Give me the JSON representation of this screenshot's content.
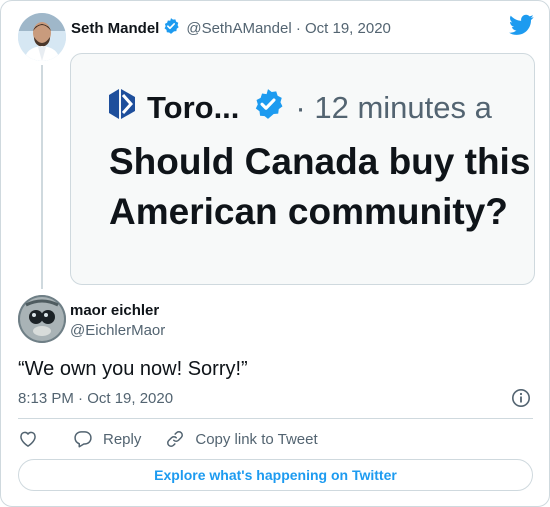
{
  "quoted_tweet": {
    "author_name": "Seth Mandel",
    "author_handle": "@SethAMandel",
    "date": "Oct 19, 2020",
    "embed": {
      "source_name": "Toro...",
      "time": "· 12 minutes a",
      "text_line1": "Should Canada buy this",
      "text_line2": "American community?"
    }
  },
  "tweet": {
    "author_name": "maor eichler",
    "author_handle": "@EichlerMaor",
    "text": "“We own you now! Sorry!”",
    "timestamp": "8:13 PM · Oct 19, 2020"
  },
  "actions": {
    "reply_label": "Reply",
    "copy_link_label": "Copy link to Tweet"
  },
  "explore_label": "Explore what's happening on Twitter",
  "colors": {
    "twitter_blue": "#1d9bf0",
    "text_primary": "#0f1419",
    "text_secondary": "#536471",
    "border": "#cfd9de",
    "toronto_brand": "#1e4f9c"
  },
  "icons": {
    "verified": "verified-badge-icon",
    "logo": "twitter-bird-icon",
    "info": "info-circle-icon",
    "like": "heart-icon",
    "reply": "speech-bubble-icon",
    "copy_link": "link-icon"
  }
}
